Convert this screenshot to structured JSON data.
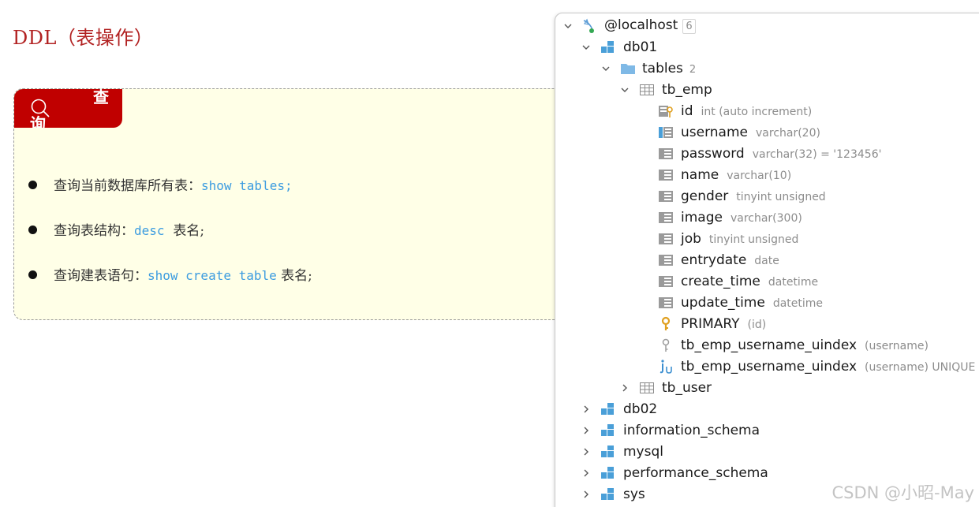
{
  "document": {
    "title": "DDL（表操作）",
    "tag_label": "查询",
    "bullets": [
      {
        "prefix": "查询当前数据库所有表：",
        "code": "show tables;",
        "suffix": ""
      },
      {
        "prefix": "查询表结构：",
        "code": "desc",
        "suffix": "表名;"
      },
      {
        "prefix": "查询建表语句：",
        "code": "show create table",
        "suffix": "表名;"
      }
    ]
  },
  "tree": {
    "root": {
      "label": "@localhost",
      "count": "6"
    },
    "db01": {
      "label": "db01"
    },
    "tables": {
      "label": "tables",
      "count": "2"
    },
    "tb_emp": {
      "label": "tb_emp"
    },
    "columns": [
      {
        "name": "id",
        "type": "int (auto increment)",
        "icon": "key-column-icon"
      },
      {
        "name": "username",
        "type": "varchar(20)",
        "icon": "indexed-column-icon"
      },
      {
        "name": "password",
        "type": "varchar(32) = '123456'",
        "icon": "column-icon"
      },
      {
        "name": "name",
        "type": "varchar(10)",
        "icon": "column-icon"
      },
      {
        "name": "gender",
        "type": "tinyint unsigned",
        "icon": "column-icon"
      },
      {
        "name": "image",
        "type": "varchar(300)",
        "icon": "column-icon"
      },
      {
        "name": "job",
        "type": "tinyint unsigned",
        "icon": "column-icon"
      },
      {
        "name": "entrydate",
        "type": "date",
        "icon": "column-icon"
      },
      {
        "name": "create_time",
        "type": "datetime",
        "icon": "column-icon"
      },
      {
        "name": "update_time",
        "type": "datetime",
        "icon": "column-icon"
      }
    ],
    "primary": {
      "label": "PRIMARY",
      "meta": "(id)"
    },
    "index": {
      "label": "tb_emp_username_uindex",
      "meta": "(username)"
    },
    "unique": {
      "label": "tb_emp_username_uindex",
      "meta": "(username) UNIQUE"
    },
    "tb_user": {
      "label": "tb_user"
    },
    "databases": [
      "db02",
      "information_schema",
      "mysql",
      "performance_schema",
      "sys"
    ]
  },
  "watermark": "CSDN @小昭-May",
  "colors": {
    "accent_red": "#c00000",
    "title_red": "#b22222",
    "code_blue": "#3c9ce0",
    "callout_bg": "#ffffe7",
    "db_icon_blue": "#4a9fd8"
  }
}
